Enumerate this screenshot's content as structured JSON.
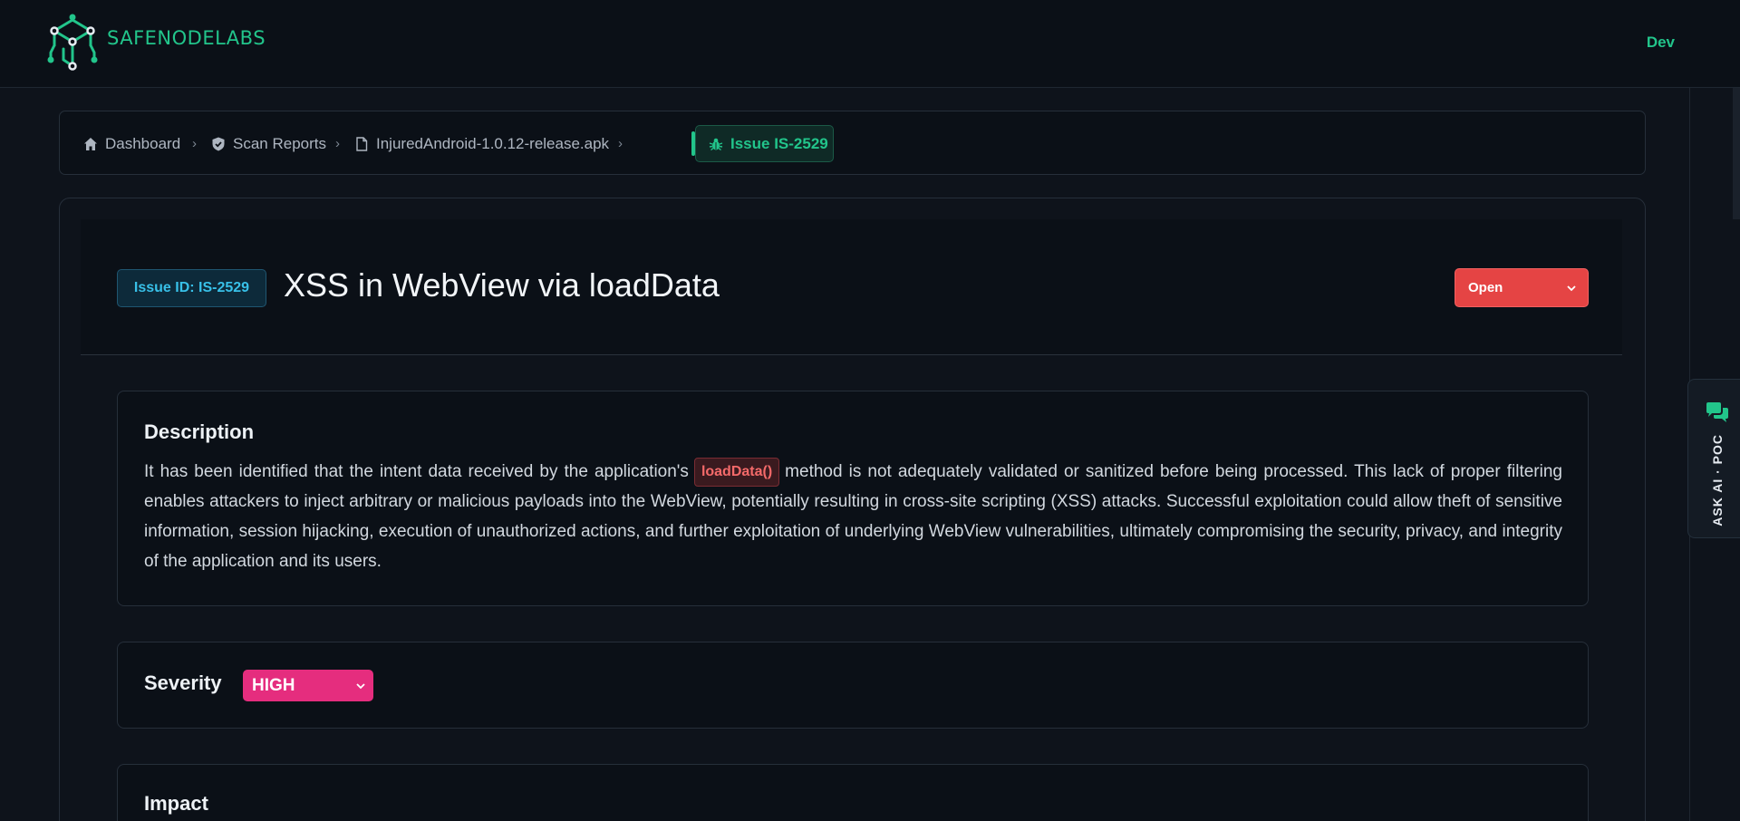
{
  "header": {
    "brand": "SAFENODELABS",
    "environment": "Dev",
    "logo_icon": "circuit-cube-logo"
  },
  "breadcrumb": {
    "items": [
      {
        "label": "Dashboard",
        "icon": "home-icon"
      },
      {
        "label": "Scan Reports",
        "icon": "shield-check-icon"
      },
      {
        "label": "InjuredAndroid-1.0.12-release.apk",
        "icon": "file-icon"
      }
    ],
    "separator": "›",
    "current": {
      "label": "Issue IS-2529",
      "icon": "bug-icon"
    }
  },
  "issue": {
    "id_badge": "Issue ID: IS-2529",
    "title": "XSS in WebView via loadData",
    "status": "Open"
  },
  "description": {
    "title": "Description",
    "text_before": "It has been identified that the intent data received by the application's",
    "code": "loadData()",
    "text_after": "method is not adequately validated or sanitized before being processed. This lack of proper filtering enables attackers to inject arbitrary or malicious payloads into the WebView, potentially resulting in cross-site scripting (XSS) attacks. Successful exploitation could allow theft of sensitive information, session hijacking, execution of unauthorized actions, and further exploitation of underlying WebView vulnerabilities, ultimately compromising the security, privacy, and integrity of the application and its users."
  },
  "severity": {
    "title": "Severity",
    "value": "HIGH"
  },
  "impact": {
    "title": "Impact"
  },
  "ask_ai": {
    "label": "ASK AI · POC",
    "icon": "chat-icon"
  },
  "colors": {
    "accent": "#22c58b",
    "status_open": "#e54444",
    "severity_high": "#e52d7e",
    "background": "#0e131b"
  }
}
